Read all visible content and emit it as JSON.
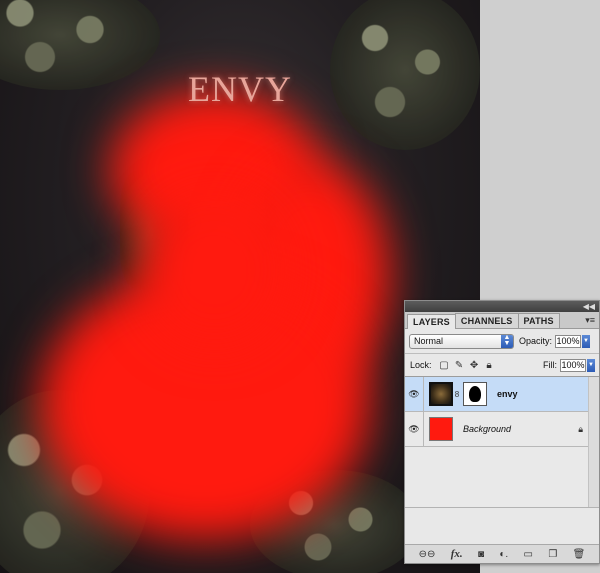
{
  "canvas": {
    "title_text": "ENVY"
  },
  "layers_panel": {
    "tabs": [
      {
        "label": "LAYERS",
        "active": true
      },
      {
        "label": "CHANNELS",
        "active": false
      },
      {
        "label": "PATHS",
        "active": false
      }
    ],
    "blend_mode": "Normal",
    "opacity_label": "Opacity:",
    "opacity_value": "100%",
    "lock_label": "Lock:",
    "fill_label": "Fill:",
    "fill_value": "100%",
    "layers": [
      {
        "name": "envy",
        "selected": true,
        "visible": true,
        "has_mask": true
      },
      {
        "name": "Background",
        "selected": false,
        "visible": true,
        "locked": true
      }
    ]
  },
  "colors": {
    "accent_red": "#ff1a0f",
    "selection_blue": "#c5dcf7"
  }
}
